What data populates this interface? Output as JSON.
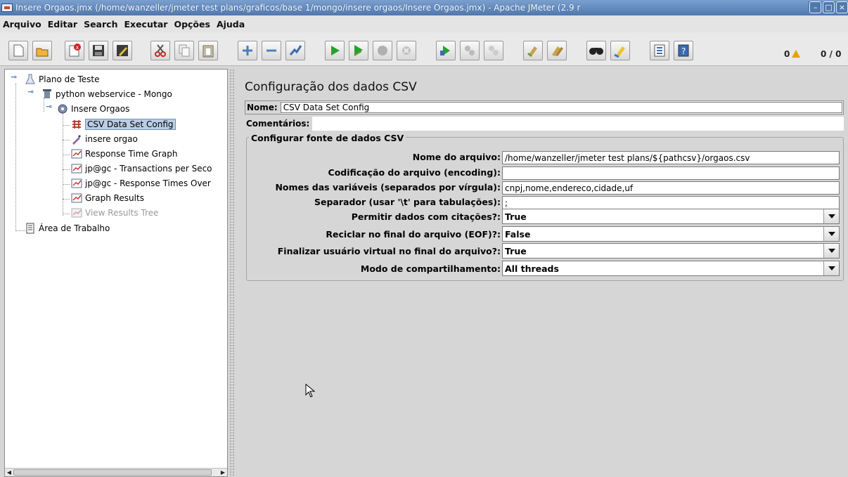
{
  "window": {
    "title": "Insere Orgaos.jmx (/home/wanzeller/jmeter test plans/graficos/base 1/mongo/insere orgaos/Insere Orgaos.jmx) - Apache JMeter (2.9 r"
  },
  "menu": [
    "Arquivo",
    "Editar",
    "Search",
    "Executar",
    "Opções",
    "Ajuda"
  ],
  "toolbar": {
    "error_count": "0",
    "thread_count": "0 / 0"
  },
  "tree": {
    "items": [
      {
        "label": "Plano de Teste"
      },
      {
        "label": "python webservice - Mongo"
      },
      {
        "label": "Insere Orgaos"
      },
      {
        "label": "CSV Data Set Config"
      },
      {
        "label": "insere orgao"
      },
      {
        "label": "Response Time Graph"
      },
      {
        "label": "jp@gc - Transactions per Seco"
      },
      {
        "label": "jp@gc - Response Times Over"
      },
      {
        "label": "Graph Results"
      },
      {
        "label": "View Results Tree"
      },
      {
        "label": "Área de Trabalho"
      }
    ]
  },
  "config": {
    "title": "Configuração dos dados CSV",
    "name_label": "Nome:",
    "name_value": "CSV Data Set Config",
    "comments_label": "Comentários:",
    "group_title": "Configurar fonte de dados CSV",
    "fields": [
      {
        "label": "Nome do arquivo:",
        "value": "/home/wanzeller/jmeter test plans/${pathcsv}/orgaos.csv"
      },
      {
        "label": "Codificação do arquivo (encoding):",
        "value": ""
      },
      {
        "label": "Nomes das variáveis (separados por vírgula):",
        "value": "cnpj,nome,endereco,cidade,uf"
      },
      {
        "label": "Separador (usar '\\t' para tabulações):",
        "value": ";"
      }
    ],
    "selects": [
      {
        "label": "Permitir dados com citações?:",
        "value": "True"
      },
      {
        "label": "Reciclar no final do arquivo (EOF)?:",
        "value": "False"
      },
      {
        "label": "Finalizar usuário virtual no final do arquivo?:",
        "value": "True"
      },
      {
        "label": "Modo de compartilhamento:",
        "value": "All threads"
      }
    ]
  }
}
